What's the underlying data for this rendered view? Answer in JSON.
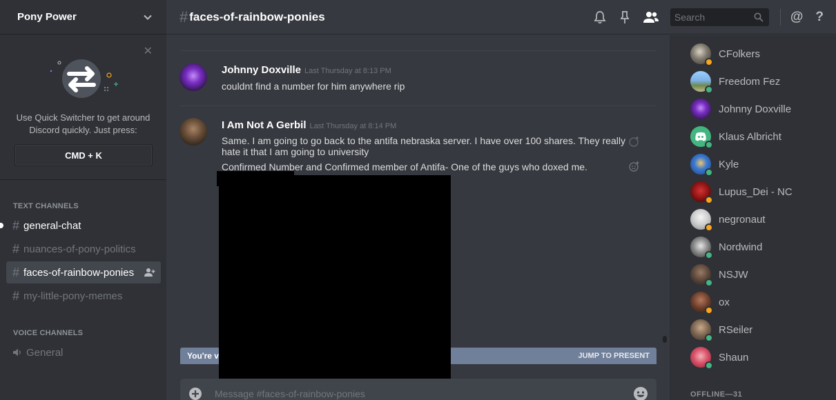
{
  "server": {
    "name": "Pony Power"
  },
  "quick_switcher": {
    "text_line1": "Use Quick Switcher to get around",
    "text_line2": "Discord quickly. Just press:",
    "shortcut": "CMD + K"
  },
  "channels": {
    "text_category": "TEXT CHANNELS",
    "text": [
      {
        "name": "general-chat",
        "state": "unread"
      },
      {
        "name": "nuances-of-pony-politics",
        "state": "normal"
      },
      {
        "name": "faces-of-rainbow-ponies",
        "state": "selected"
      },
      {
        "name": "my-little-pony-memes",
        "state": "normal"
      }
    ],
    "voice_category": "VOICE CHANNELS",
    "voice": [
      {
        "name": "General"
      }
    ]
  },
  "header": {
    "hash": "#",
    "channel_name": "faces-of-rainbow-ponies",
    "search_placeholder": "Search",
    "mention_glyph": "@",
    "help_glyph": "?"
  },
  "messages": [
    {
      "author": "Johnny Doxville",
      "timestamp": "Last Thursday at 8:13 PM",
      "lines": [
        "couldnt find a number for him anywhere rip"
      ]
    },
    {
      "author": "I Am Not A Gerbil",
      "timestamp": "Last Thursday at 8:14 PM",
      "lines": [
        "Same. I am going to go back to the antifa nebraska server. I have over 100 shares. They really",
        "hate it that I am going to university",
        "Confirmed Number and Confirmed member of Antifa- One of the guys who doxed me."
      ]
    }
  ],
  "new_messages_bar": {
    "text": "You're v",
    "jump": "JUMP TO PRESENT"
  },
  "composer": {
    "placeholder": "Message #faces-of-rainbow-ponies"
  },
  "members": {
    "list": [
      {
        "name": "CFolkers",
        "status": "idle"
      },
      {
        "name": "Freedom Fez",
        "status": "online"
      },
      {
        "name": "Johnny Doxville",
        "status": "none"
      },
      {
        "name": "Klaus Albricht",
        "status": "online"
      },
      {
        "name": "Kyle",
        "status": "online"
      },
      {
        "name": "Lupus_Dei - NC",
        "status": "idle"
      },
      {
        "name": "negronaut",
        "status": "idle"
      },
      {
        "name": "Nordwind",
        "status": "online"
      },
      {
        "name": "NSJW",
        "status": "online"
      },
      {
        "name": "ox",
        "status": "idle"
      },
      {
        "name": "RSeiler",
        "status": "online"
      },
      {
        "name": "Shaun",
        "status": "online"
      }
    ],
    "offline_category": "OFFLINE—31"
  },
  "colors": {
    "online": "#43b581",
    "idle": "#faa61a",
    "background": "#36393f",
    "sidebar": "#2f3136"
  }
}
